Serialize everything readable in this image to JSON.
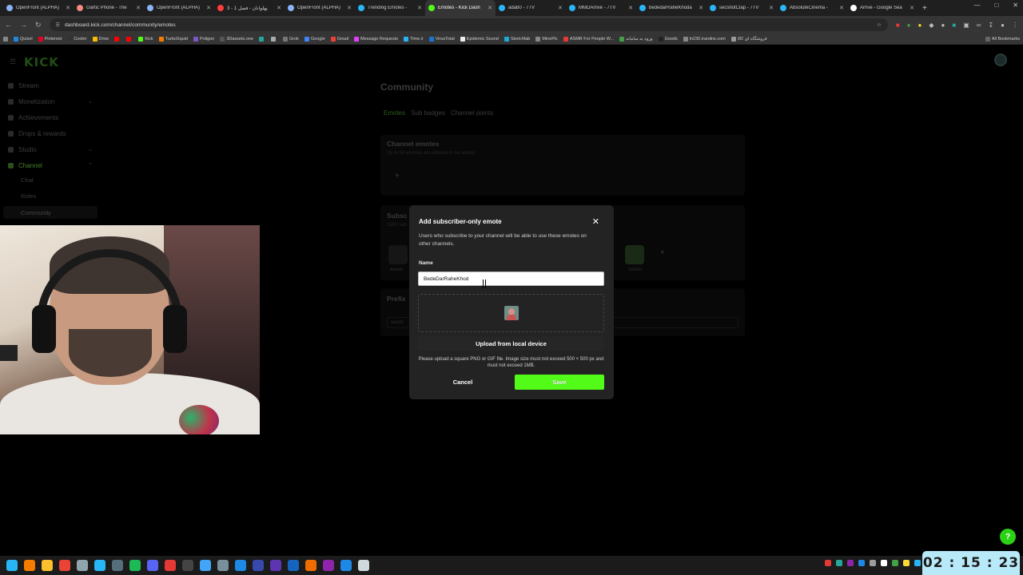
{
  "browser": {
    "tabs": [
      {
        "title": "OpenFront (ALPHA)",
        "color": "#8ab4f8"
      },
      {
        "title": "Gartic Phone - The",
        "color": "#f28b82"
      },
      {
        "title": "OpenFront (ALPHA)",
        "color": "#8ab4f8"
      },
      {
        "title": "پهلوانان - فصل 1 - 3",
        "color": "#ff3d3d"
      },
      {
        "title": "OpenFront (ALPHA)",
        "color": "#8ab4f8"
      },
      {
        "title": "Trending Emotes -",
        "color": "#29b6f6"
      },
      {
        "title": "Emotes - Kick Dash",
        "color": "#53fc18",
        "active": true
      },
      {
        "title": "adab0 - 7TV",
        "color": "#29b6f6"
      },
      {
        "title": "MMDArrive - 7TV",
        "color": "#29b6f6"
      },
      {
        "title": "bededarRaheKhoda",
        "color": "#29b6f6"
      },
      {
        "title": "secshotClap - 7TV",
        "color": "#29b6f6"
      },
      {
        "title": "AbsoluteCinema -",
        "color": "#29b6f6"
      },
      {
        "title": "Arrive - Google Sea",
        "color": "#ffffff"
      }
    ],
    "url": "dashboard.kick.com/channel/community/emotes",
    "bookmarks": [
      {
        "label": "Quixel",
        "color": "#1e88e5"
      },
      {
        "label": "Pinterest",
        "color": "#e60023"
      },
      {
        "label": "Cooler",
        "color": "#333333"
      },
      {
        "label": "Drive",
        "color": "#fbbc05"
      },
      {
        "label": "",
        "color": "#ff0000"
      },
      {
        "label": "",
        "color": "#ff0000"
      },
      {
        "label": "Kick",
        "color": "#53fc18"
      },
      {
        "label": "TurboSquid",
        "color": "#f57c00"
      },
      {
        "label": "Poligon",
        "color": "#7e57c2"
      },
      {
        "label": "3Dassets.one",
        "color": "#555555"
      },
      {
        "label": "",
        "color": "#26a69a"
      },
      {
        "label": "",
        "color": "#aaaaaa"
      },
      {
        "label": "Grok",
        "color": "#777777"
      },
      {
        "label": "Google",
        "color": "#4285f4"
      },
      {
        "label": "Gmail",
        "color": "#ea4335"
      },
      {
        "label": "Message Requests",
        "color": "#e040fb"
      },
      {
        "label": "Time.ir",
        "color": "#29b6f6"
      },
      {
        "label": "VirusTotal",
        "color": "#1976d2"
      },
      {
        "label": "Epidemic Sound",
        "color": "#eeeeee"
      },
      {
        "label": "Sketchfab",
        "color": "#1caad9"
      },
      {
        "label": "MinePic",
        "color": "#888888"
      },
      {
        "label": "ASMR For People W...",
        "color": "#e53935"
      },
      {
        "label": "ورود به سامانه",
        "color": "#43a047"
      },
      {
        "label": "Goods",
        "color": "#222222"
      },
      {
        "label": "ln230.irandns.com",
        "color": "#888888"
      },
      {
        "label": "فروشگاه ای کالا",
        "color": "#999999"
      }
    ],
    "all_bookmarks": "All Bookmarks"
  },
  "kick": {
    "logo": "KICK",
    "sidebar": [
      {
        "label": "Stream",
        "chevron": false
      },
      {
        "label": "Monetization",
        "chevron": "down"
      },
      {
        "label": "Achievements",
        "chevron": false
      },
      {
        "label": "Drops & rewards",
        "chevron": false
      },
      {
        "label": "Studio",
        "chevron": "down"
      },
      {
        "label": "Channel",
        "chevron": "up",
        "active": true
      }
    ],
    "channel_sub": [
      "Chat",
      "Roles",
      "Community"
    ],
    "page_title": "Community",
    "tabs": [
      "Emotes",
      "Sub badges",
      "Channel points"
    ],
    "channel_emotes_title": "Channel emotes",
    "channel_emotes_sub": "Up to 50 emotes are allowed to be added",
    "sub_emotes_title": "Subsc",
    "sub_emotes_sub": "1950 sub",
    "emote_names": [
      "Adab0",
      "SHISH"
    ],
    "prefix_title": "Prefix",
    "prefix_value": "secsh"
  },
  "modal": {
    "title": "Add subscriber-only emote",
    "description": "Users who subscribe to your channel will be able to use these emotes on other channels.",
    "name_label": "Name",
    "name_value": "BedeDarRaheKhod",
    "upload_label": "Upload from local device",
    "upload_note": "Please upload a square PNG or GIF file. Image size must not exceed 500 × 500 px and must not exceed 1MB.",
    "cancel_label": "Cancel",
    "save_label": "Save"
  },
  "taskbar": {
    "icons": [
      {
        "name": "windows-start",
        "color": "#29b6f6"
      },
      {
        "name": "search",
        "color": "#f57c00"
      },
      {
        "name": "file-explorer",
        "color": "#fbc02d"
      },
      {
        "name": "chrome",
        "color": "#ea4335"
      },
      {
        "name": "app",
        "color": "#90a4ae"
      },
      {
        "name": "telegram",
        "color": "#29b6f6"
      },
      {
        "name": "steam",
        "color": "#546e7a"
      },
      {
        "name": "spotify",
        "color": "#1db954"
      },
      {
        "name": "discord",
        "color": "#5865f2"
      },
      {
        "name": "davinci",
        "color": "#e53935"
      },
      {
        "name": "obs",
        "color": "#444444"
      },
      {
        "name": "photos",
        "color": "#42a5f5"
      },
      {
        "name": "screenshot",
        "color": "#78909c"
      },
      {
        "name": "word",
        "color": "#1e88e5"
      },
      {
        "name": "after-effects",
        "color": "#3949ab"
      },
      {
        "name": "premiere",
        "color": "#5e35b1"
      },
      {
        "name": "photoshop",
        "color": "#1565c0"
      },
      {
        "name": "blender",
        "color": "#ef6c00"
      },
      {
        "name": "r-app",
        "color": "#8e24aa"
      },
      {
        "name": "app-blue",
        "color": "#1e88e5"
      },
      {
        "name": "pen",
        "color": "#cfd8dc"
      }
    ],
    "tray": [
      "#e53935",
      "#26a69a",
      "#8e24aa",
      "#1e88e5",
      "#9e9e9e",
      "#ffffff",
      "#43a047",
      "#fdd835",
      "#29b6f6"
    ],
    "clock": "02 : 15 : 23"
  }
}
